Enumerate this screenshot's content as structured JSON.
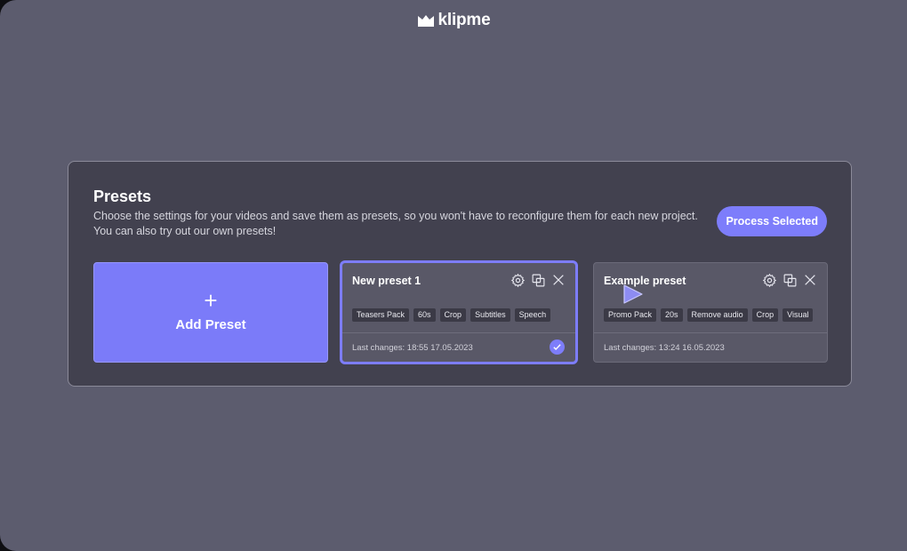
{
  "brand": {
    "name": "klipme"
  },
  "presets": {
    "title": "Presets",
    "description_line1": "Choose the settings for your videos and save them as presets, so you won't have to reconfigure them for each new project.",
    "description_line2": "You can also try out our own presets!",
    "process_button": "Process Selected",
    "add_card": {
      "plus": "+",
      "label": "Add Preset"
    },
    "cards": [
      {
        "title": "New preset 1",
        "selected": true,
        "tags": [
          "Teasers Pack",
          "60s",
          "Crop",
          "Subtitles",
          "Speech"
        ],
        "last_changes": "Last changes: 18:55 17.05.2023"
      },
      {
        "title": "Example preset",
        "selected": false,
        "tags": [
          "Promo Pack",
          "20s",
          "Remove audio",
          "Crop",
          "Visual"
        ],
        "last_changes": "Last changes: 13:24 16.05.2023"
      }
    ]
  },
  "icons": [
    "logo-icon",
    "gear-icon",
    "duplicate-icon",
    "close-icon",
    "check-icon",
    "cursor-icon"
  ],
  "colors": {
    "accent": "#7d7dfb",
    "background": "#5c5c6e",
    "panel": "#42414f",
    "card": "#595867"
  }
}
